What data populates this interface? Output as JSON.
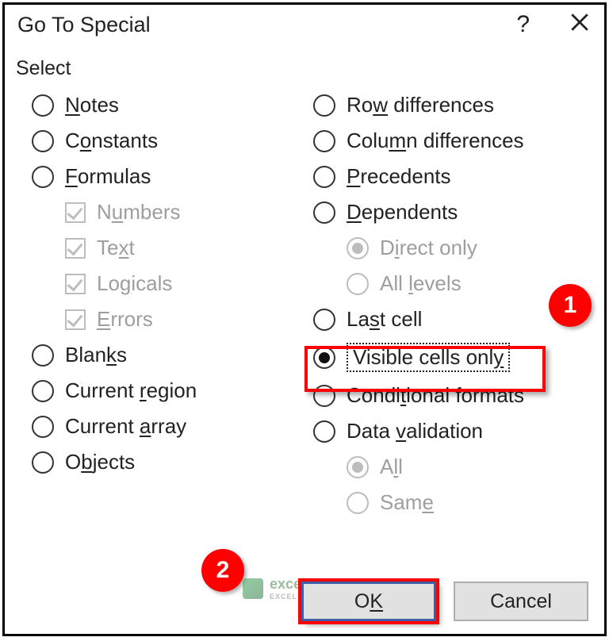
{
  "dialog": {
    "title": "Go To Special",
    "help": "?",
    "close": "✕"
  },
  "group_label": "Select",
  "left": {
    "notes": "Notes",
    "constants": "Constants",
    "formulas": "Formulas",
    "numbers": "Numbers",
    "text": "Text",
    "logicals": "Logicals",
    "errors": "Errors",
    "blanks": "Blanks",
    "current_region": "Current region",
    "current_array": "Current array",
    "objects": "Objects"
  },
  "right": {
    "row_diff": "Row differences",
    "col_diff": "Column differences",
    "precedents": "Precedents",
    "dependents": "Dependents",
    "direct_only": "Direct only",
    "all_levels": "All levels",
    "last_cell": "Last cell",
    "visible_cells": "Visible cells only",
    "cond_formats": "Conditional formats",
    "data_validation": "Data validation",
    "all": "All",
    "same": "Same"
  },
  "buttons": {
    "ok": "OK",
    "cancel": "Cancel"
  },
  "badges": {
    "b1": "1",
    "b2": "2"
  },
  "watermark": {
    "name": "exceldemy",
    "sub": "EXCEL · DATA · BI"
  }
}
